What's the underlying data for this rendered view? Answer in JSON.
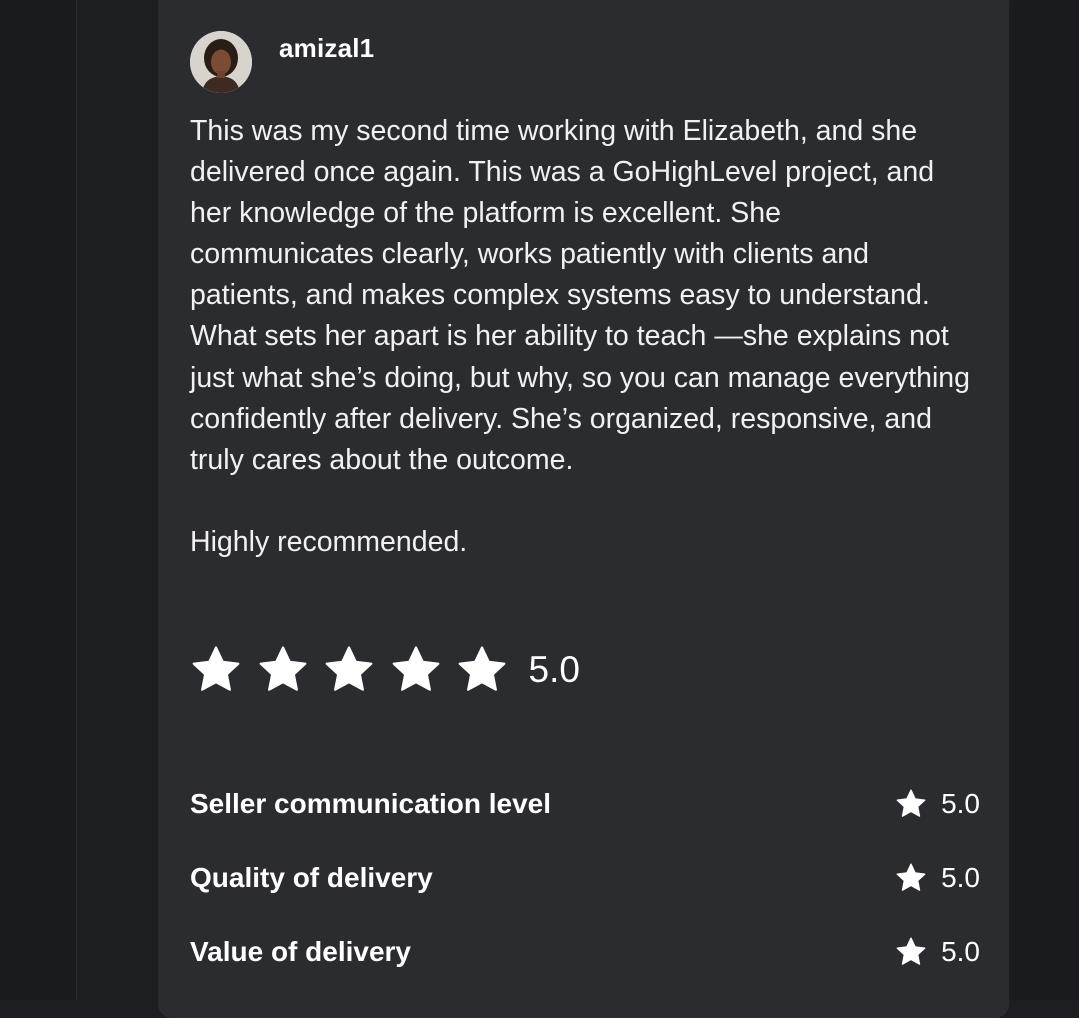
{
  "review": {
    "username": "amizal1",
    "paragraphs": [
      "This was my second time working with Elizabeth, and she delivered once again. This was a GoHighLevel project, and her knowledge of the platform is excellent. She communicates clearly, works patiently with clients and patients, and makes complex systems easy to understand. What sets her apart is her ability to teach —she explains not just what she’s doing, but why, so you can manage everything confidently after delivery. She’s organized, responsive, and truly cares about the outcome.",
      "Highly recommended."
    ],
    "overall_rating": "5.0",
    "overall_stars": 5,
    "sub_ratings": [
      {
        "label": "Seller communication level",
        "value": "5.0"
      },
      {
        "label": "Quality of delivery",
        "value": "5.0"
      },
      {
        "label": "Value of delivery",
        "value": "5.0"
      }
    ]
  },
  "icons": {
    "star": "star-icon",
    "avatar": "user-avatar"
  },
  "colors": {
    "background": "#1d1e21",
    "card": "#2b2c30",
    "text": "#ffffff",
    "star": "#ffffff"
  }
}
